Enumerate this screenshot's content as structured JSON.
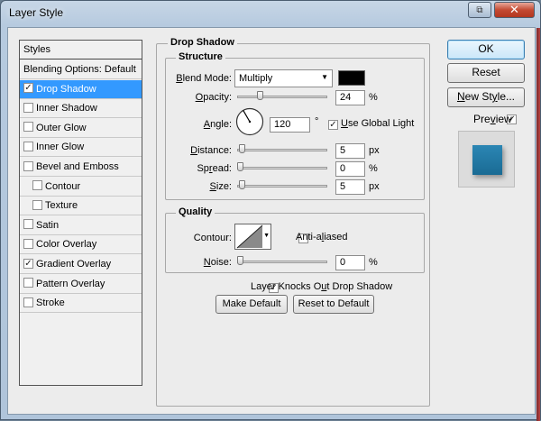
{
  "window": {
    "title": "Layer Style"
  },
  "titlebar": {
    "restore_glyph": "⧉",
    "close_glyph": "✕"
  },
  "styles_list": {
    "header": "Styles",
    "items": [
      {
        "label": "Blending Options: Default",
        "checkbox": false,
        "checked": false,
        "selected": false,
        "indent": false
      },
      {
        "label": "Drop Shadow",
        "checkbox": true,
        "checked": true,
        "selected": true,
        "indent": false
      },
      {
        "label": "Inner Shadow",
        "checkbox": true,
        "checked": false,
        "selected": false,
        "indent": false
      },
      {
        "label": "Outer Glow",
        "checkbox": true,
        "checked": false,
        "selected": false,
        "indent": false
      },
      {
        "label": "Inner Glow",
        "checkbox": true,
        "checked": false,
        "selected": false,
        "indent": false
      },
      {
        "label": "Bevel and Emboss",
        "checkbox": true,
        "checked": false,
        "selected": false,
        "indent": false
      },
      {
        "label": "Contour",
        "checkbox": true,
        "checked": false,
        "selected": false,
        "indent": true
      },
      {
        "label": "Texture",
        "checkbox": true,
        "checked": false,
        "selected": false,
        "indent": true
      },
      {
        "label": "Satin",
        "checkbox": true,
        "checked": false,
        "selected": false,
        "indent": false
      },
      {
        "label": "Color Overlay",
        "checkbox": true,
        "checked": false,
        "selected": false,
        "indent": false
      },
      {
        "label": "Gradient Overlay",
        "checkbox": true,
        "checked": true,
        "selected": false,
        "indent": false
      },
      {
        "label": "Pattern Overlay",
        "checkbox": true,
        "checked": false,
        "selected": false,
        "indent": false
      },
      {
        "label": "Stroke",
        "checkbox": true,
        "checked": false,
        "selected": false,
        "indent": false
      }
    ]
  },
  "drop_shadow": {
    "title": "Drop Shadow",
    "structure": {
      "title": "Structure",
      "blend_mode": {
        "label": "Blend Mode:",
        "value": "Multiply",
        "color": "#000000"
      },
      "opacity": {
        "label": "Opacity:",
        "value": "24",
        "unit": "%",
        "level": 0.24
      },
      "angle": {
        "label": "Angle:",
        "value": "120",
        "unit": "°",
        "use_global_light": true,
        "use_global_light_label": "Use Global Light"
      },
      "distance": {
        "label": "Distance:",
        "value": "5",
        "unit": "px",
        "level": 0.02
      },
      "spread": {
        "label": "Spread:",
        "value": "0",
        "unit": "%",
        "level": 0.0
      },
      "size": {
        "label": "Size:",
        "value": "5",
        "unit": "px",
        "level": 0.02
      }
    },
    "quality": {
      "title": "Quality",
      "contour_label": "Contour:",
      "anti_aliased": false,
      "anti_aliased_label": "Anti-aliased",
      "noise": {
        "label": "Noise:",
        "value": "0",
        "unit": "%",
        "level": 0.0
      }
    },
    "layer_knocks_out": true,
    "layer_knocks_out_label": "Layer Knocks Out Drop Shadow",
    "make_default_label": "Make Default",
    "reset_default_label": "Reset to Default"
  },
  "actions": {
    "ok": "OK",
    "reset": "Reset",
    "new_style": "New Style...",
    "preview_label": "Preview",
    "preview_checked": true,
    "preview_color": "#1a6b94"
  },
  "colors": {
    "selection": "#3399ff",
    "window_frame": "#b6cadf",
    "client_bg": "#ececec"
  }
}
